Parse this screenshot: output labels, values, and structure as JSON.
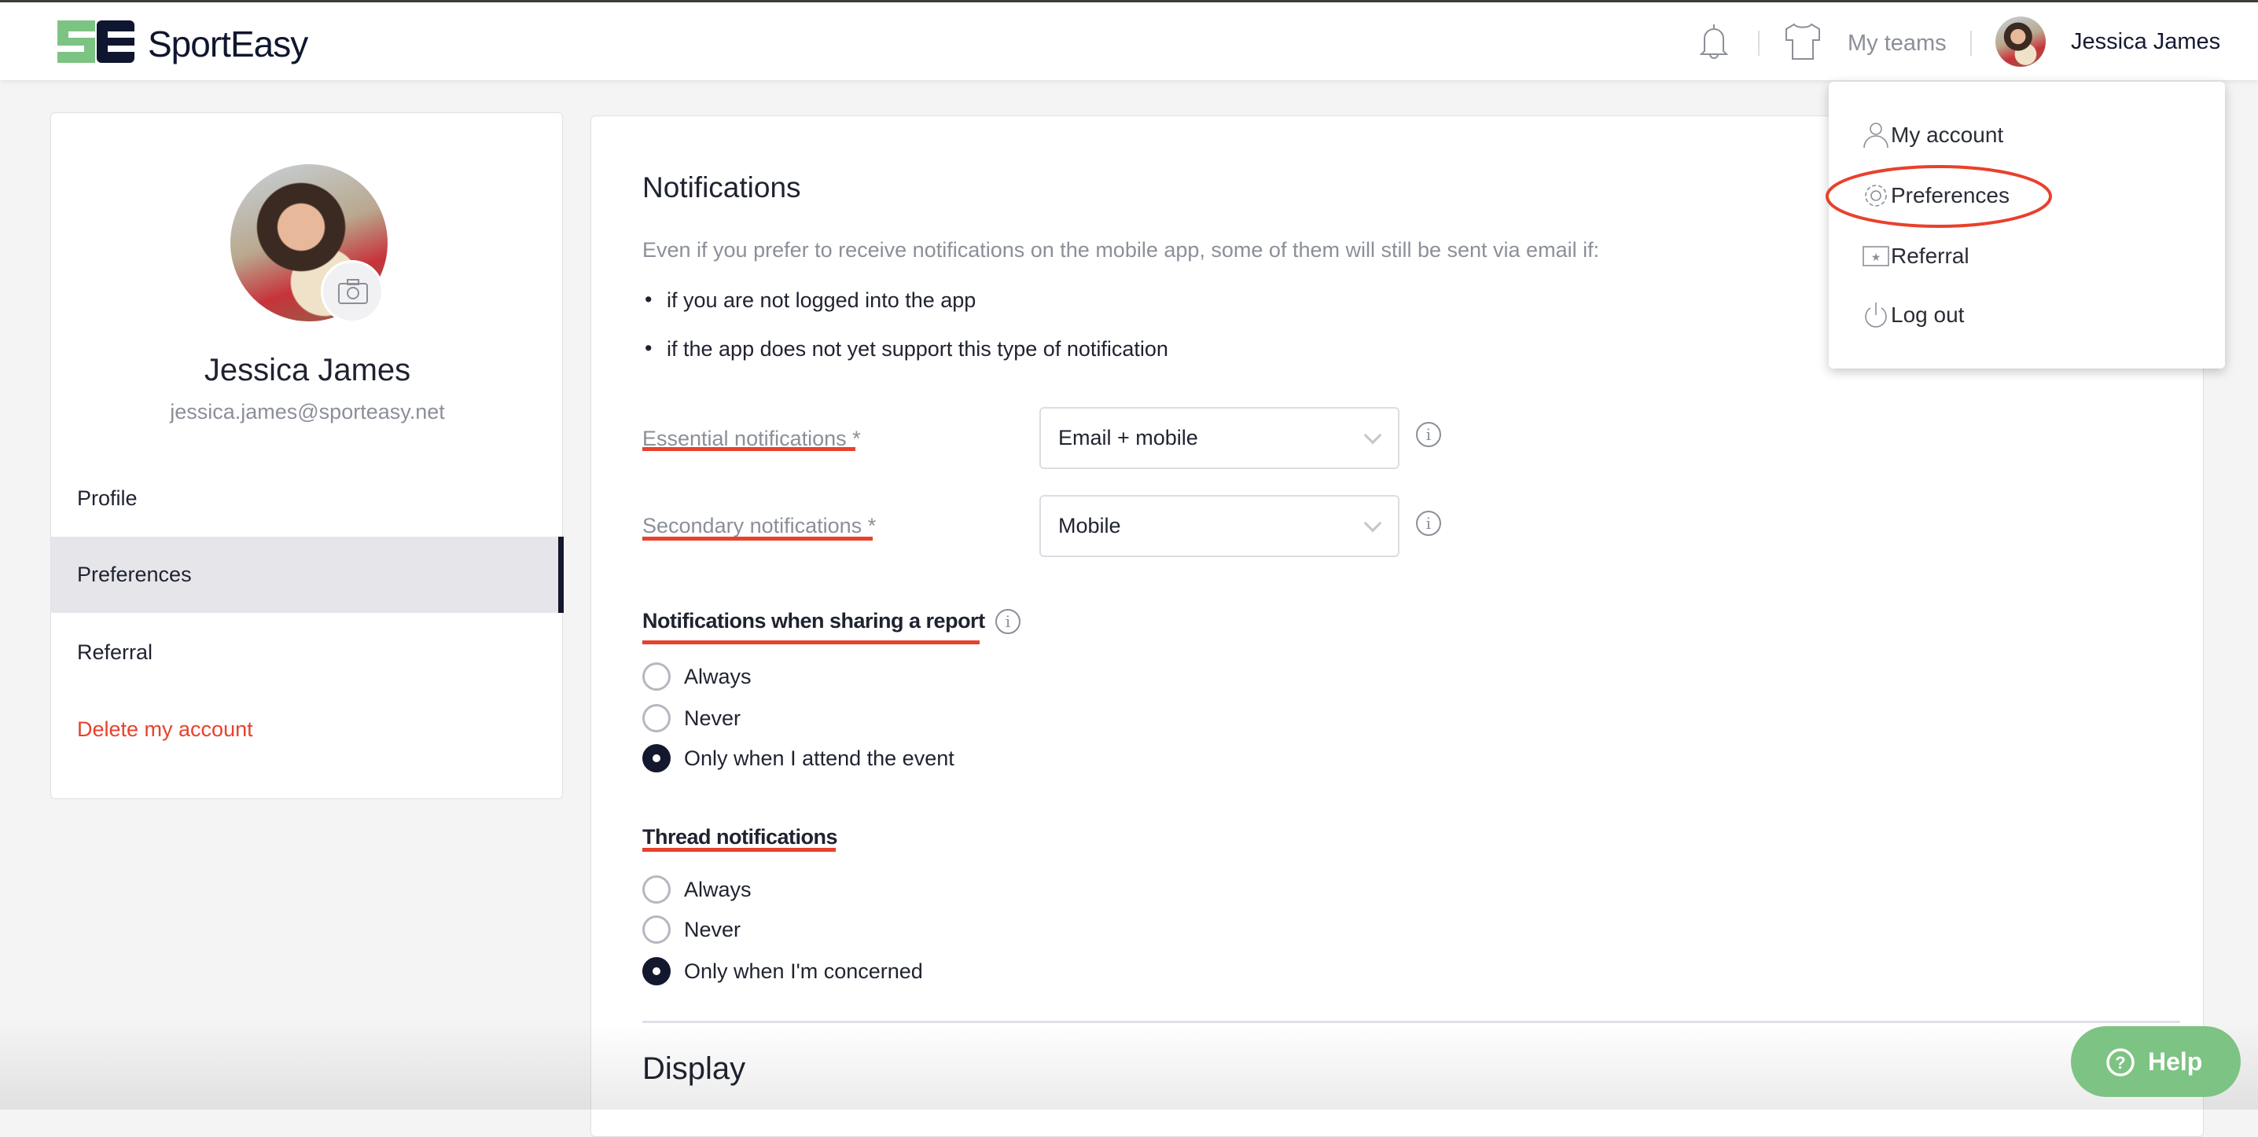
{
  "header": {
    "brand": "SportEasy",
    "my_teams": "My teams",
    "user_name": "Jessica James"
  },
  "dropdown": {
    "items": [
      {
        "label": "My account",
        "icon": "user-icon"
      },
      {
        "label": "Preferences",
        "icon": "gear-icon",
        "highlighted": true
      },
      {
        "label": "Referral",
        "icon": "ticket-icon"
      },
      {
        "label": "Log out",
        "icon": "power-icon"
      }
    ]
  },
  "sidebar": {
    "name": "Jessica James",
    "email": "jessica.james@sporteasy.net",
    "items": [
      {
        "label": "Profile"
      },
      {
        "label": "Preferences",
        "active": true
      },
      {
        "label": "Referral"
      },
      {
        "label": "Delete my account",
        "color": "#e8412c"
      }
    ]
  },
  "main": {
    "title": "Notifications",
    "intro": "Even if you prefer to receive notifications on the mobile app, some of them will still be sent via email if:",
    "bullets": [
      "if you are not logged into the app",
      "if the app does not yet support this type of notification"
    ],
    "essential": {
      "label": "Essential notifications",
      "required": "*",
      "value": "Email + mobile"
    },
    "secondary": {
      "label": "Secondary notifications",
      "required": "*",
      "value": "Mobile"
    },
    "sharing": {
      "title": "Notifications when sharing a report",
      "options": [
        "Always",
        "Never",
        "Only when I attend the event"
      ],
      "selected": 2
    },
    "thread": {
      "title": "Thread notifications",
      "options": [
        "Always",
        "Never",
        "Only when I'm concerned"
      ],
      "selected": 2
    },
    "display_title": "Display"
  },
  "help": {
    "label": "Help"
  },
  "colors": {
    "brand_green": "#7dc383",
    "navy": "#14182e",
    "annotation_red": "#e8412c"
  }
}
